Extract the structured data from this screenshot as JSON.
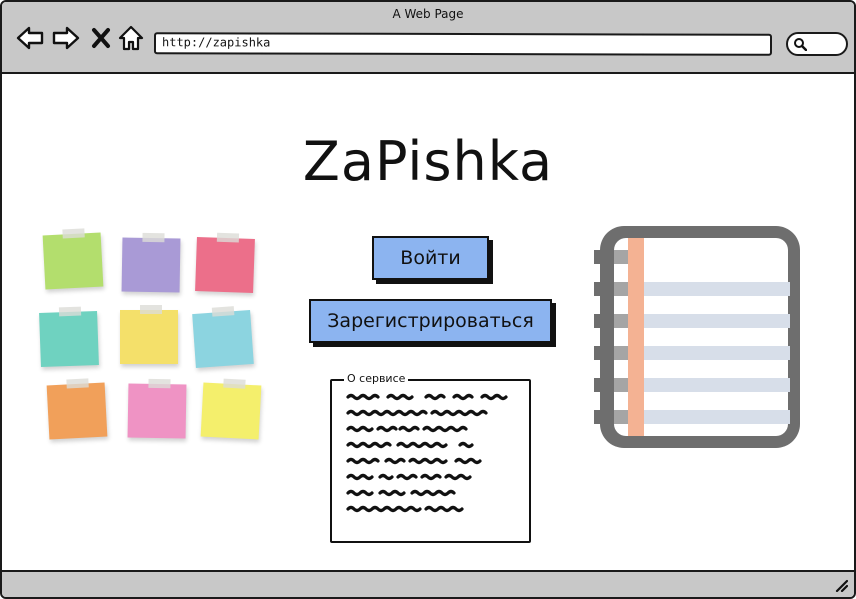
{
  "window": {
    "title": "A Web Page"
  },
  "browser": {
    "url": "http://zapishka",
    "icons": [
      "back-arrow-icon",
      "forward-arrow-icon",
      "close-x-icon",
      "home-icon",
      "search-icon",
      "resize-grip-icon"
    ]
  },
  "page": {
    "title": "ZaPishka",
    "login_label": "Войти",
    "register_label": "Зарегистрироваться",
    "about": {
      "legend": "О сервисе"
    }
  },
  "images": {
    "sticky_notes": {
      "colors": [
        "#b3de6d",
        "#a99ad6",
        "#ec6f8a",
        "#6fd2c0",
        "#f4e06a",
        "#8cd4e0",
        "#f1a05a",
        "#ef93c4",
        "#f4ef6c"
      ]
    },
    "notebook": {
      "frame_color": "#6e6e6e",
      "margin_color": "#f4b293",
      "line_color": "#d7dee9"
    }
  },
  "colors": {
    "button_fill": "#8cb4f0",
    "chrome": "#c8c8c8"
  }
}
